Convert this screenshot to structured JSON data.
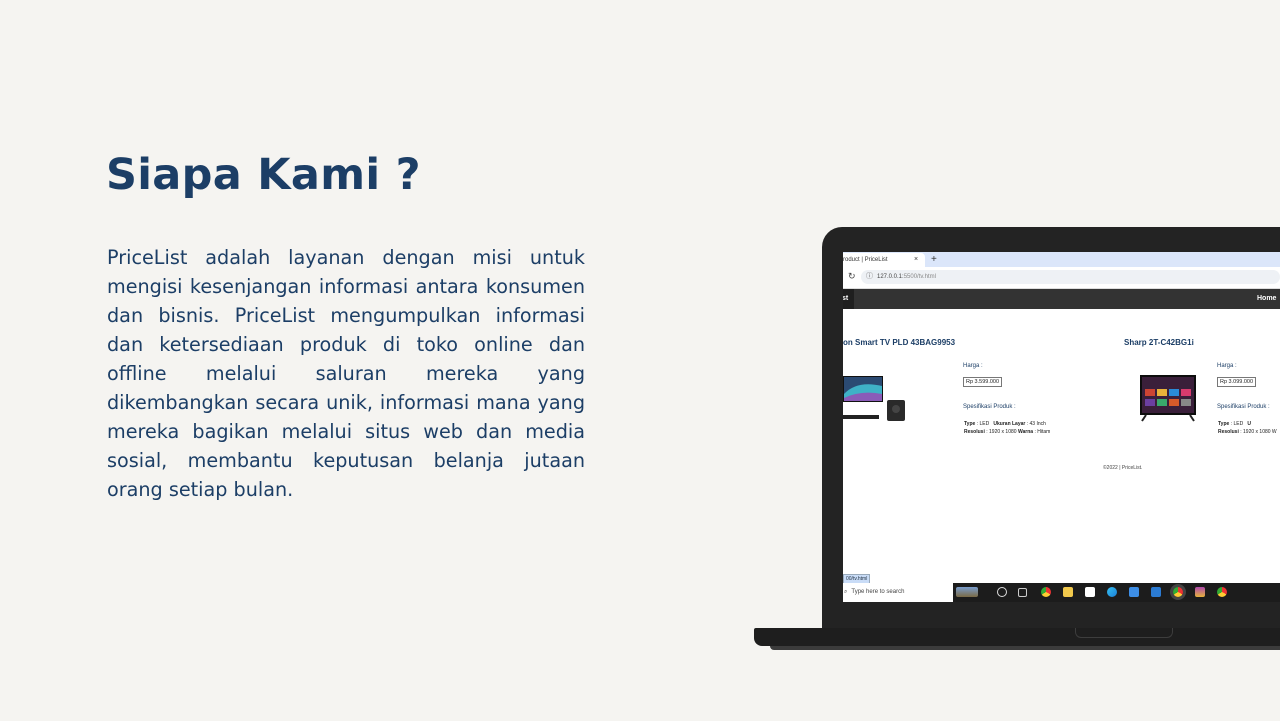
{
  "heading": "Siapa Kami ?",
  "description": "PriceList adalah layanan dengan misi untuk mengisi kesenjangan informasi antara konsumen dan bisnis. PriceList mengumpulkan informasi dan ketersediaan produk di toko online dan offline melalui saluran mereka yang dikembangkan secara unik, informasi mana yang mereka bagikan melalui situs web dan media sosial, membantu keputusan belanja jutaan orang setiap bulan.",
  "browser": {
    "tab_title": "roduct | PriceList",
    "tab_close": "×",
    "new_tab": "+",
    "reload_icon": "reload-icon",
    "url_host": "127.0.0.1:",
    "url_path": "5500/tv.html"
  },
  "site": {
    "nav_brand": "st",
    "nav_home": "Home",
    "products": [
      {
        "name": "on Smart TV PLD 43BAG9953",
        "price_label": "Harga :",
        "price": "Rp 3.599.000",
        "spec_label": "Spesifikasi Produk :",
        "specs": {
          "type_key": "Type",
          "type_val": ": LED",
          "size_key": "Ukuran Layar",
          "size_val": ": 43 Inch",
          "res_key": "Resolusi",
          "res_val": ": 1920 x 1080",
          "color_key": "Warna",
          "color_val": ": Hitam"
        }
      },
      {
        "name": "Sharp 2T-C42BG1i",
        "price_label": "Harga :",
        "price": "Rp 3.099.000",
        "spec_label": "Spesifikasi Produk :",
        "specs": {
          "type_key": "Type",
          "type_val": ": LED",
          "size_key": "U",
          "size_val": "",
          "res_key": "Resolusi",
          "res_val": ": 1920 x 1080 W",
          "color_key": "",
          "color_val": ""
        }
      }
    ],
    "footer": "©2022 | PriceList."
  },
  "status_link": "00/tv.html",
  "taskbar": {
    "search_placeholder": "Type here to search",
    "icons": [
      "search-icon",
      "cortana-icon",
      "task-view-icon",
      "chrome-icon",
      "file-explorer-icon",
      "calendar-icon",
      "edge-icon",
      "mail-icon",
      "vscode-icon",
      "chrome-icon",
      "winrar-icon",
      "chrome-icon"
    ]
  },
  "colors": {
    "heading": "#1c3e66",
    "background": "#f5f4f1",
    "laptop": "#232323"
  }
}
